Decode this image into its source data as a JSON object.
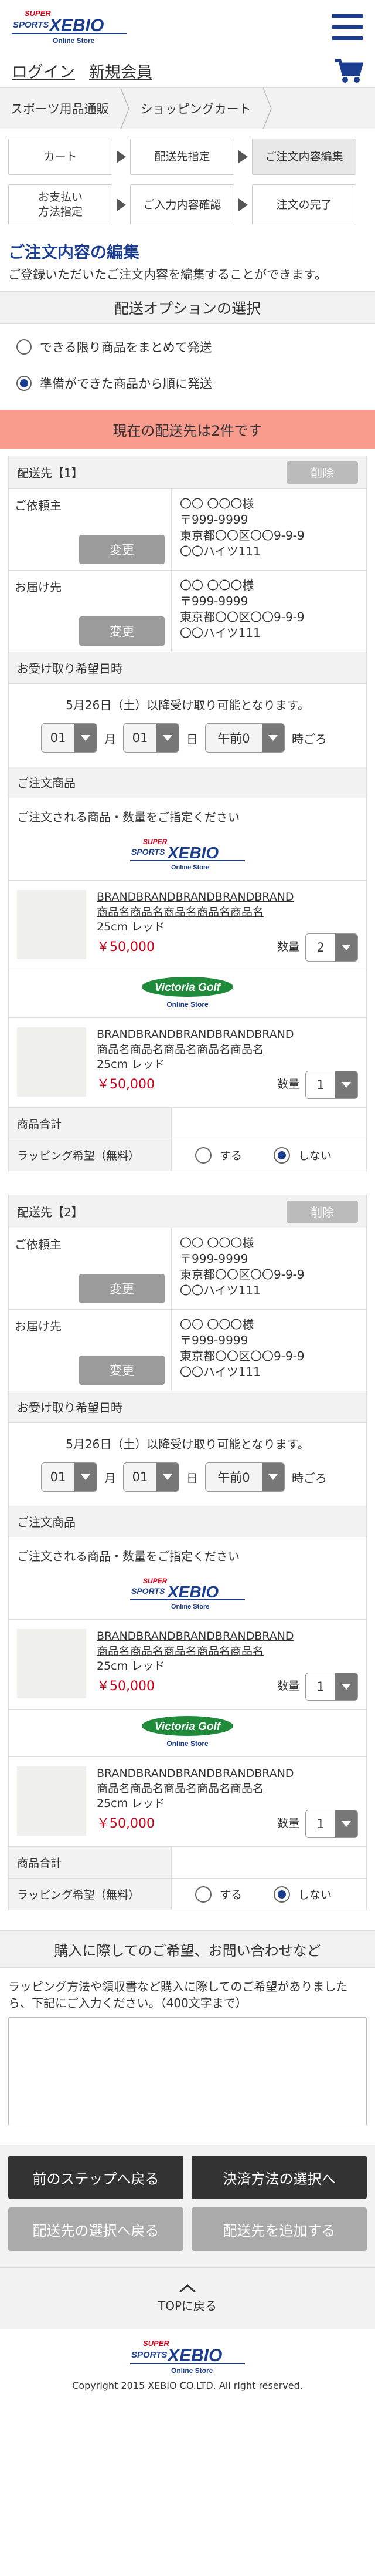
{
  "brand": {
    "super_line": "SUPER",
    "sports_line": "SPORTS",
    "xebio_line": "XEBIO",
    "online_line": "Online Store"
  },
  "header": {
    "menu_icon": "hamburger-menu-icon",
    "cart_icon": "shopping-cart-icon"
  },
  "subheader": {
    "login": "ログイン",
    "signup": "新規会員"
  },
  "breadcrumb": [
    "スポーツ用品通販",
    "ショッピングカート"
  ],
  "steps": {
    "cart": "カート",
    "delivery": "配送先指定",
    "order_edit": "ご注文内容編集",
    "payment_line1": "お支払い",
    "payment_line2": "方法指定",
    "confirm": "ご入力内容確認",
    "complete": "注文の完了"
  },
  "page": {
    "title": "ご注文内容の編集",
    "desc": "ご登録いただいたご注文内容を編集することができます。"
  },
  "delivery_option": {
    "title": "配送オプションの選択",
    "option_together": "できる限り商品をまとめて発送",
    "option_ready": "準備ができた商品から順に発送"
  },
  "notice": "現在の配送先は2件です",
  "colors": {
    "brand_blue": "#1a3d8f",
    "notice_bg": "#f99c8e",
    "price_red": "#d0021b"
  },
  "shipments": [
    {
      "label": "配送先【1】",
      "delete": "削除",
      "requester_label": "ご依頼主",
      "change": "変更",
      "requester": {
        "name": "〇〇 〇〇〇様",
        "zip": "〒999-9999",
        "addr1": "東京都〇〇区〇〇9-9-9",
        "addr2": "〇〇ハイツ111"
      },
      "recipient_label": "お届け先",
      "recipient": {
        "name": "〇〇 〇〇〇様",
        "zip": "〒999-9999",
        "addr1": "東京都〇〇区〇〇9-9-9",
        "addr2": "〇〇ハイツ111"
      },
      "date_head": "お受け取り希望日時",
      "date_note": "5月26日（土）以降受け取り可能となります。",
      "month": "01",
      "month_unit": "月",
      "day": "01",
      "day_unit": "日",
      "time": "午前0",
      "time_unit": "時ごろ",
      "products_head": "ご注文商品",
      "products_note": "ご注文される商品・数量をご指定ください",
      "items": [
        {
          "name1": "BRANDBRANDBRANDBRANDBRAND",
          "name2": "商品名商品名商品名商品名商品名",
          "variant": "25cm レッド",
          "price": "￥50,000",
          "qty_label": "数量",
          "qty": "2"
        },
        {
          "name1": "BRANDBRANDBRANDBRANDBRAND",
          "name2": "商品名商品名商品名商品名商品名",
          "variant": "25cm レッド",
          "price": "￥50,000",
          "qty_label": "数量",
          "qty": "1"
        }
      ],
      "subtotal_label": "商品合計",
      "wrap_label": "ラッピング希望（無料）",
      "wrap_yes": "する",
      "wrap_no": "しない"
    },
    {
      "label": "配送先【2】",
      "delete": "削除",
      "requester_label": "ご依頼主",
      "change": "変更",
      "requester": {
        "name": "〇〇 〇〇〇様",
        "zip": "〒999-9999",
        "addr1": "東京都〇〇区〇〇9-9-9",
        "addr2": "〇〇ハイツ111"
      },
      "recipient_label": "お届け先",
      "recipient": {
        "name": "〇〇 〇〇〇様",
        "zip": "〒999-9999",
        "addr1": "東京都〇〇区〇〇9-9-9",
        "addr2": "〇〇ハイツ111"
      },
      "date_head": "お受け取り希望日時",
      "date_note": "5月26日（土）以降受け取り可能となります。",
      "month": "01",
      "month_unit": "月",
      "day": "01",
      "day_unit": "日",
      "time": "午前0",
      "time_unit": "時ごろ",
      "products_head": "ご注文商品",
      "products_note": "ご注文される商品・数量をご指定ください",
      "items": [
        {
          "name1": "BRANDBRANDBRANDBRANDBRAND",
          "name2": "商品名商品名商品名商品名商品名",
          "variant": "25cm レッド",
          "price": "￥50,000",
          "qty_label": "数量",
          "qty": "1"
        },
        {
          "name1": "BRANDBRANDBRANDBRANDBRAND",
          "name2": "商品名商品名商品名商品名商品名",
          "variant": "25cm レッド",
          "price": "￥50,000",
          "qty_label": "数量",
          "qty": "1"
        }
      ],
      "subtotal_label": "商品合計",
      "wrap_label": "ラッピング希望（無料）",
      "wrap_yes": "する",
      "wrap_no": "しない"
    }
  ],
  "victoria": {
    "top": "Victoria Golf",
    "bottom": "Online Store"
  },
  "inquiry": {
    "title": "購入に際してのご希望、お問い合わせなど",
    "desc": "ラッピング方法や領収書など購入に際してのご希望がありましたら、下記にご入力ください。（400文字まで）",
    "value": ""
  },
  "buttons": {
    "prev": "前のステップへ戻る",
    "payment": "決済方法の選択へ",
    "back_delivery": "配送先の選択へ戻る",
    "add_delivery": "配送先を追加する"
  },
  "top_link": "TOPに戻る",
  "copyright": "Copyright 2015 XEBIO CO.LTD. All right reserved."
}
